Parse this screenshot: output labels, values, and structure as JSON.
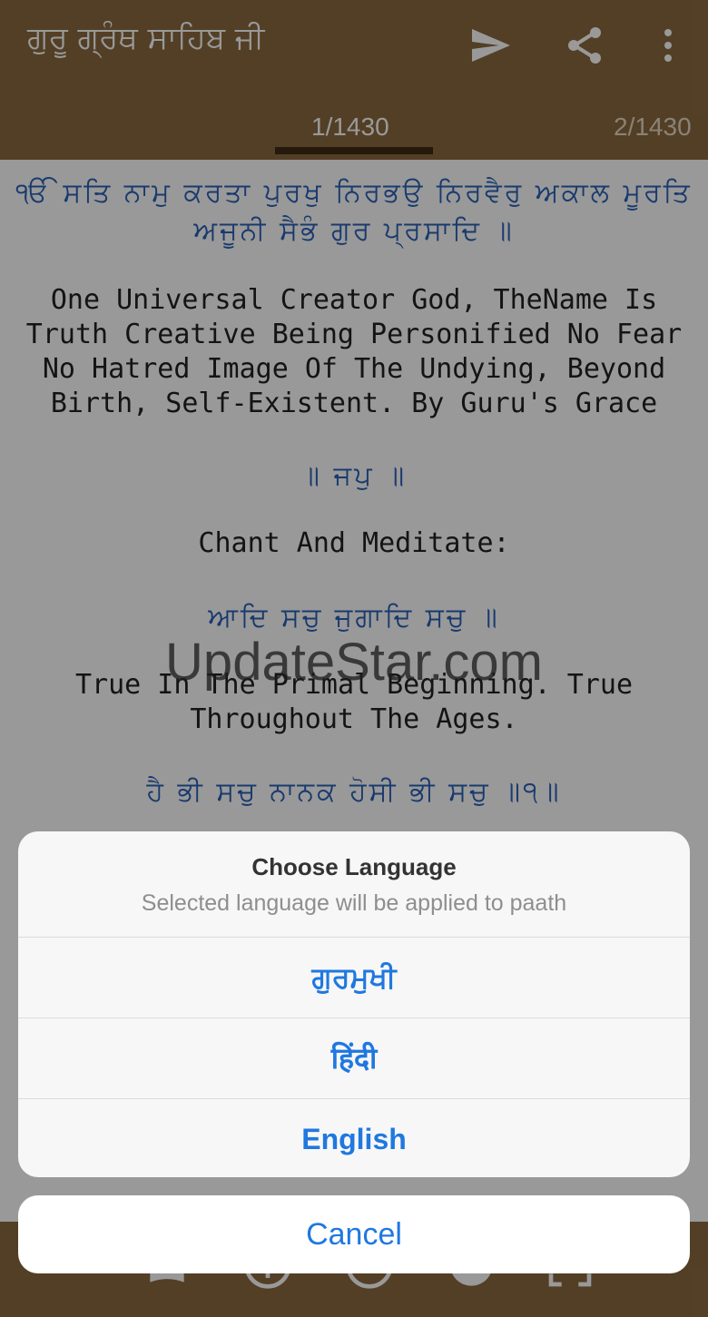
{
  "app": {
    "title": "ਗੁਰੂ ਗ੍ਰੰਥ ਸਾਹਿਬ ਜੀ",
    "actions": [
      "send-icon",
      "share-icon",
      "more-vert-icon"
    ]
  },
  "tabs": [
    {
      "label": "1/1430",
      "selected": true
    },
    {
      "label": "2/1430",
      "selected": false
    }
  ],
  "verses": [
    {
      "gurmukhi": "ੴ ਸਤਿ ਨਾਮੁ ਕਰਤਾ ਪੁਰਖੁ ਨਿਰਭਉ ਨਿਰਵੈਰੁ ਅਕਾਲ ਮੂਰਤਿ",
      "gurmukhi2": "ਅਜੂਨੀ ਸੈਭੰ ਗੁਰ ਪ੍ਰਸਾਦਿ ॥"
    },
    {
      "english": [
        "One Universal Creator God, TheName Is",
        "Truth Creative Being Personified No Fear",
        "No Hatred Image Of The Undying, Beyond",
        "Birth, Self-Existent. By Guru's Grace"
      ]
    },
    {
      "gurmukhi": "॥ ਜਪੁ ॥"
    },
    {
      "english": [
        "Chant And Meditate:"
      ]
    },
    {
      "gurmukhi": "ਆਦਿ ਸਚੁ ਜੁਗਾਦਿ ਸਚੁ ॥"
    },
    {
      "english": [
        "True In The Primal Beginning. True",
        "Throughout The Ages."
      ]
    },
    {
      "gurmukhi": "ਹੈ ਭੀ ਸਚੁ ਨਾਨਕ ਹੋਸੀ ਭੀ ਸਚੁ ॥੧॥"
    }
  ],
  "watermark": "UpdateStar.com",
  "dialog": {
    "title": "Choose Language",
    "subtitle": "Selected language will be applied to paath",
    "options": [
      "ਗੁਰਮੁਖੀ",
      "हिंदी",
      "English"
    ],
    "cancel": "Cancel"
  },
  "colors": {
    "appbar": "#8a6a3f",
    "gurmukhi_text": "#2a62b8",
    "action_blue": "#1f78e0"
  },
  "bottom_bar": {
    "icons": [
      "bookmark-icon",
      "info-icon",
      "circle-icon",
      "night-mode-icon",
      "fullscreen-icon"
    ]
  }
}
